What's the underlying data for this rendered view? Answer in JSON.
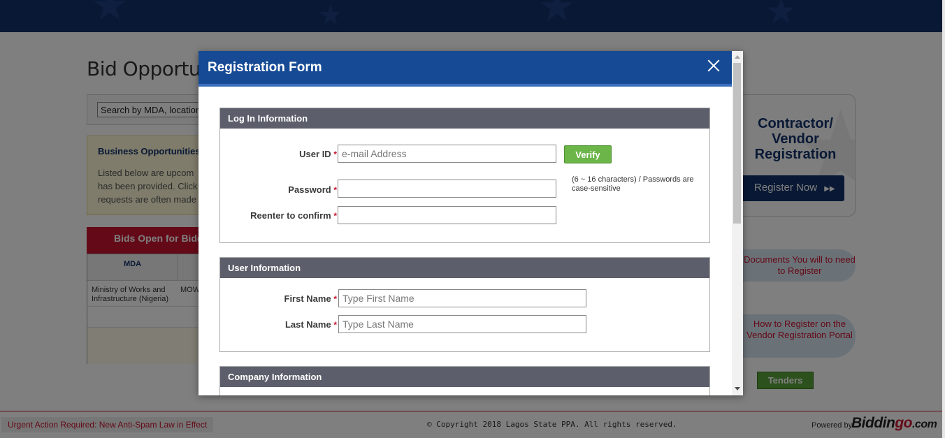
{
  "background": {
    "page_title": "Bid Opportur",
    "search_value": "Search by MDA, location",
    "business": {
      "title": "Business Opportunities",
      "lines": [
        "Listed below are upcom",
        "has been provided. Click",
        "requests are often made"
      ]
    },
    "bids_header": "Bids Open for Biddi",
    "table": {
      "col_mda": "MDA",
      "row1_mda": "Ministry of Works and Infrastructure (Nigeria)",
      "row1_code": "MOW"
    },
    "contractor_title": "Contractor/ Vendor Registration",
    "register_now": "Register Now",
    "register_now_icon": "double-arrow-right-icon",
    "documents_link": "Documents You will to need to Register",
    "how_to_link": "How to Register on the Vendor Registration Portal",
    "tenders": "Tenders",
    "footer": {
      "urgent": "Urgent Action Required: New Anti-Spam Law in Effect",
      "copyright": "© Copyright 2018 Lagos State PPA. All rights reserved.",
      "powered_by": "Powered by",
      "brand_main": "Biddin",
      "brand_accent": "go",
      "brand_suffix": ".com"
    }
  },
  "modal": {
    "title": "Registration Form",
    "close_icon": "close-icon",
    "required_mark": "*",
    "login_section": {
      "title": "Log In Information",
      "user_id_label": "User ID",
      "user_id_placeholder": "e-mail Address",
      "verify_label": "Verify",
      "password_label": "Password",
      "password_hint": "(6 ~ 16 characters)  /  Passwords are case-sensitive",
      "confirm_label": "Reenter to confirm"
    },
    "user_section": {
      "title": "User Information",
      "first_name_label": "First Name",
      "first_name_placeholder": "Type First Name",
      "last_name_label": "Last Name",
      "last_name_placeholder": "Type Last Name"
    },
    "company_section": {
      "title": "Company Information"
    }
  },
  "colors": {
    "header_blue": "#164a95",
    "section_gray": "#5c5f6b",
    "verify_green": "#6cb548",
    "required_red": "#c9122e"
  }
}
